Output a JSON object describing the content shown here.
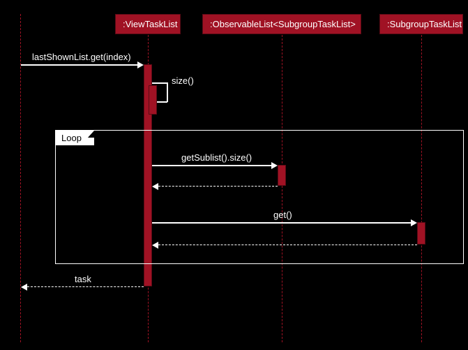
{
  "chart_data": {
    "type": "sequence-diagram",
    "participants": [
      {
        "id": "caller",
        "label": ""
      },
      {
        "id": "viewTaskList",
        "label": ":ViewTaskList"
      },
      {
        "id": "observableList",
        "label": ":ObservableList<SubgroupTaskList>"
      },
      {
        "id": "subgroupTaskList",
        "label": ":SubgroupTaskList"
      }
    ],
    "messages": [
      {
        "from": "caller",
        "to": "viewTaskList",
        "text": "lastShownList.get(index)",
        "type": "call"
      },
      {
        "from": "viewTaskList",
        "to": "viewTaskList",
        "text": "size()",
        "type": "self-call"
      },
      {
        "fragment": "loop",
        "label": "Loop",
        "contains": [
          {
            "from": "viewTaskList",
            "to": "observableList",
            "text": "getSublist().size()",
            "type": "call"
          },
          {
            "from": "observableList",
            "to": "viewTaskList",
            "text": "",
            "type": "return"
          },
          {
            "from": "viewTaskList",
            "to": "subgroupTaskList",
            "text": "get()",
            "type": "call"
          },
          {
            "from": "subgroupTaskList",
            "to": "viewTaskList",
            "text": "",
            "type": "return"
          }
        ]
      },
      {
        "from": "viewTaskList",
        "to": "caller",
        "text": "task",
        "type": "return"
      }
    ]
  },
  "participants": {
    "p1": ":ViewTaskList",
    "p2": ":ObservableList<SubgroupTaskList>",
    "p3": ":SubgroupTaskList"
  },
  "messages": {
    "m1": "lastShownList.get(index)",
    "m2": "size()",
    "m3": "getSublist().size()",
    "m4": "get()",
    "ret": "task"
  },
  "fragment": {
    "loop": "Loop"
  }
}
